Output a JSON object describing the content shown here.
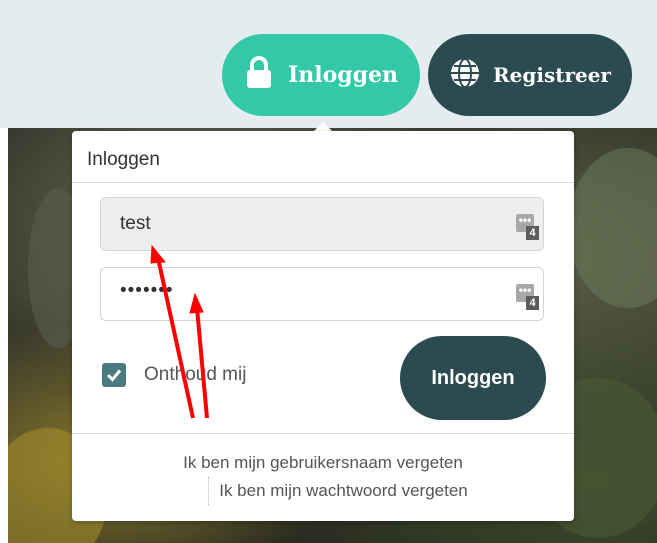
{
  "header": {
    "login_label": "Inloggen",
    "register_label": "Registreer"
  },
  "login_panel": {
    "title": "Inloggen",
    "username_value": "test",
    "password_value": "•••••••",
    "password_manager_count": "4",
    "remember_label": "Onthoud mij",
    "remember_checked": true,
    "submit_label": "Inloggen",
    "forgot_username": "Ik ben mijn gebruikersnaam vergeten",
    "forgot_password": "Ik ben mijn wachtwoord vergeten"
  },
  "colors": {
    "login_accent": "#33c9a7",
    "dark_teal": "#2c4b51",
    "annotation_arrow": "#ff0000"
  }
}
